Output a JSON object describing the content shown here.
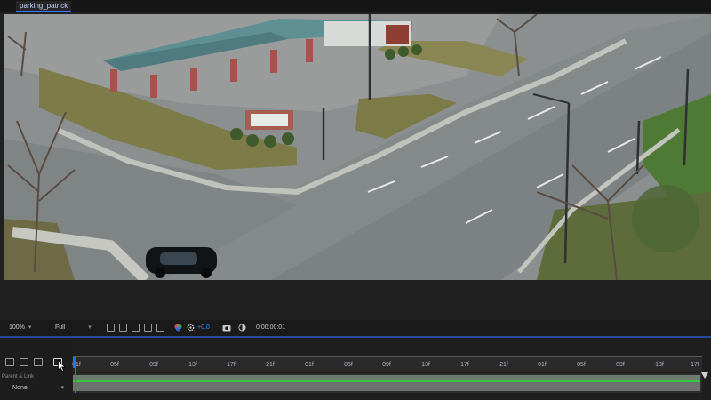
{
  "window": {
    "comp_tab": "parking_patrick"
  },
  "viewer_controls": {
    "zoom": "100%",
    "resolution": "Full",
    "exposure": "+0.0",
    "timecode": "0:00:00:01"
  },
  "timeline": {
    "parent_link_label": "Parent & Link",
    "parent_value": "None",
    "ruler_ticks": [
      "01f",
      "05f",
      "09f",
      "13f",
      "17f",
      "21f",
      "01f",
      "05f",
      "09f",
      "13f",
      "17f",
      "21f",
      "01f",
      "05f",
      "09f",
      "13f",
      "17f"
    ]
  },
  "icons": [
    "toggle-icon",
    "camera-icon",
    "channel-icon",
    "region-icon",
    "transparency-icon",
    "mask-icon",
    "color-wheel-icon",
    "gear-icon",
    "snapshot-icon",
    "show-snapshot-icon",
    "draft-3d-icon",
    "comp-icon",
    "motion-blur-icon",
    "graph-icon",
    "mouse-pointer-icon"
  ],
  "colors": {
    "accent": "#2b6cff",
    "track_green": "#33c83d"
  }
}
